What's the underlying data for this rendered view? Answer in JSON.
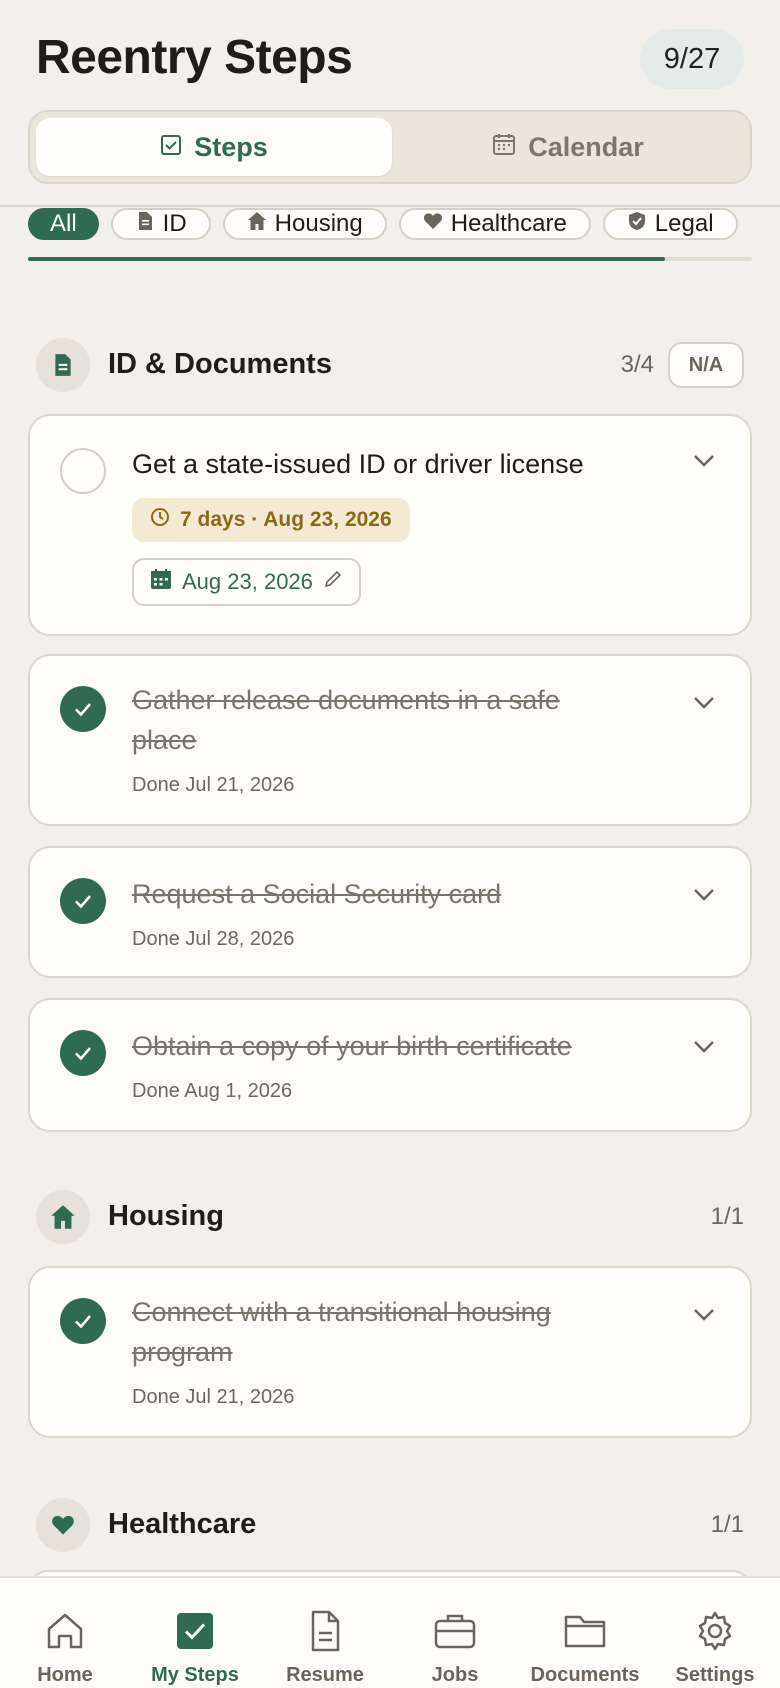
{
  "header": {
    "title": "Reentry Steps",
    "progress": "9/27",
    "tabs": [
      {
        "label": "Steps",
        "active": true,
        "icon": "checkbox-icon"
      },
      {
        "label": "Calendar",
        "active": false,
        "icon": "calendar-icon"
      }
    ]
  },
  "filters": [
    {
      "label": "All",
      "active": true
    },
    {
      "label": "ID",
      "icon": "document-icon"
    },
    {
      "label": "Housing",
      "icon": "home-icon"
    },
    {
      "label": "Healthcare",
      "icon": "heart-icon"
    },
    {
      "label": "Legal",
      "icon": "shield-icon"
    }
  ],
  "filter_scroll_progress": 0.88,
  "sections": {
    "id_documents": {
      "title": "ID & Documents",
      "count": "3/4",
      "na_label": "N/A",
      "tasks": [
        {
          "title": "Get a state-issued ID or driver license",
          "done": false,
          "due_badge": "7 days · Aug 23, 2026",
          "date_button": "Aug 23, 2026"
        },
        {
          "title": "Gather release documents in a safe place",
          "done": true,
          "done_label": "Done Jul 21, 2026"
        },
        {
          "title": "Request a Social Security card",
          "done": true,
          "done_label": "Done Jul 28, 2026"
        },
        {
          "title": "Obtain a copy of your birth certificate",
          "done": true,
          "done_label": "Done Aug 1, 2026"
        }
      ]
    },
    "housing": {
      "title": "Housing",
      "count": "1/1",
      "tasks": [
        {
          "title": "Connect with a transitional housing program",
          "done": true,
          "done_label": "Done Jul 21, 2026"
        }
      ]
    },
    "healthcare": {
      "title": "Healthcare",
      "count": "1/1"
    }
  },
  "bottom_nav": [
    {
      "label": "Home",
      "icon": "home-icon"
    },
    {
      "label": "My Steps",
      "icon": "checkbox-icon",
      "active": true
    },
    {
      "label": "Resume",
      "icon": "document-icon"
    },
    {
      "label": "Jobs",
      "icon": "briefcase-icon"
    },
    {
      "label": "Documents",
      "icon": "folder-icon"
    },
    {
      "label": "Settings",
      "icon": "gear-icon"
    }
  ],
  "colors": {
    "accent": "#2f6b50",
    "background": "#f3f0eb",
    "card": "#fffdf9",
    "due_text": "#8b6914",
    "due_bg": "#f4ead3"
  }
}
